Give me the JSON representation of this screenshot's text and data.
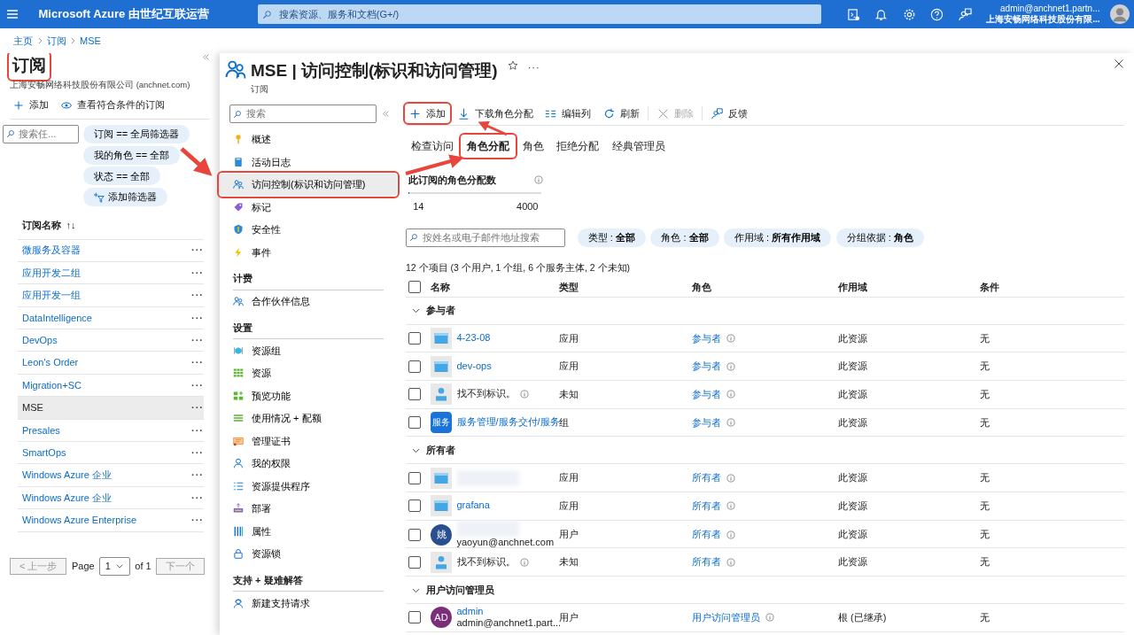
{
  "topbar": {
    "brand": "Microsoft Azure 由世纪互联运营",
    "search": {
      "placeholder": "搜索资源、服务和文档(G+/)"
    },
    "account": {
      "email": "admin@anchnet1.partn...",
      "org": "上海安畅网络科技股份有限..."
    }
  },
  "breadcrumb": [
    "主页",
    "订阅",
    "MSE"
  ],
  "subscriptions": {
    "title": "订阅",
    "annotated": true,
    "subtitle": "上海安畅网络科技股份有限公司 (anchnet.com)",
    "toolbar": [
      "添加",
      "查看符合条件的订阅"
    ],
    "search": {
      "placeholder": "搜索任..."
    },
    "filters": [
      {
        "label": "订阅 == 全局筛选器",
        "kind": "filter"
      },
      {
        "label": "我的角色 == 全部",
        "kind": "filter"
      },
      {
        "label": "状态 == 全部",
        "kind": "filter"
      },
      {
        "label": "添加筛选器",
        "kind": "add"
      }
    ],
    "column": "订阅名称",
    "sort": "↑↓",
    "rows": [
      {
        "name": "微服务及容器",
        "more": "···",
        "selected": false
      },
      {
        "name": "应用开发二组",
        "more": "···",
        "selected": false
      },
      {
        "name": "应用开发一组",
        "more": "···",
        "selected": false
      },
      {
        "name": "DataIntelligence",
        "more": "···",
        "selected": false
      },
      {
        "name": "DevOps",
        "more": "···",
        "selected": false
      },
      {
        "name": "Leon's Order",
        "more": "···",
        "selected": false
      },
      {
        "name": "Migration+SC",
        "more": "···",
        "selected": false
      },
      {
        "name": "MSE",
        "more": "···",
        "selected": true
      },
      {
        "name": "Presales",
        "more": "···",
        "selected": false
      },
      {
        "name": "SmartOps",
        "more": "···",
        "selected": false
      },
      {
        "name": "Windows Azure 企业",
        "more": "···",
        "selected": false
      },
      {
        "name": "Windows Azure 企业",
        "more": "···",
        "selected": false
      },
      {
        "name": "Windows Azure Enterprise",
        "more": "···",
        "selected": false
      }
    ],
    "pagination": {
      "prev": "< 上一步",
      "page_label": "Page",
      "page": "1",
      "of": "of 1",
      "next": "下一个"
    }
  },
  "blade": {
    "title": "MSE | 访问控制(标识和访问管理)",
    "subtitle": "订阅",
    "more": "···",
    "nav_search": {
      "placeholder": "搜索"
    },
    "nav": [
      {
        "kind": "item",
        "label": "概述",
        "selected": false,
        "annotated": false
      },
      {
        "kind": "item",
        "label": "活动日志",
        "selected": false,
        "annotated": false
      },
      {
        "kind": "item",
        "label": "访问控制(标识和访问管理)",
        "selected": true,
        "annotated": true
      },
      {
        "kind": "item",
        "label": "标记",
        "selected": false,
        "annotated": false
      },
      {
        "kind": "item",
        "label": "安全性",
        "selected": false,
        "annotated": false
      },
      {
        "kind": "item",
        "label": "事件",
        "selected": false,
        "annotated": false
      },
      {
        "kind": "header",
        "label": "计费"
      },
      {
        "kind": "item",
        "label": "合作伙伴信息",
        "selected": false,
        "annotated": false
      },
      {
        "kind": "header",
        "label": "设置"
      },
      {
        "kind": "item",
        "label": "资源组",
        "selected": false,
        "annotated": false
      },
      {
        "kind": "item",
        "label": "资源",
        "selected": false,
        "annotated": false
      },
      {
        "kind": "item",
        "label": "预览功能",
        "selected": false,
        "annotated": false
      },
      {
        "kind": "item",
        "label": "使用情况 + 配额",
        "selected": false,
        "annotated": false
      },
      {
        "kind": "item",
        "label": "管理证书",
        "selected": false,
        "annotated": false
      },
      {
        "kind": "item",
        "label": "我的权限",
        "selected": false,
        "annotated": false
      },
      {
        "kind": "item",
        "label": "资源提供程序",
        "selected": false,
        "annotated": false
      },
      {
        "kind": "item",
        "label": "部署",
        "selected": false,
        "annotated": false
      },
      {
        "kind": "item",
        "label": "属性",
        "selected": false,
        "annotated": false
      },
      {
        "kind": "item",
        "label": "资源锁",
        "selected": false,
        "annotated": false
      },
      {
        "kind": "header",
        "label": "支持 + 疑难解答"
      },
      {
        "kind": "item",
        "label": "新建支持请求",
        "selected": false,
        "annotated": false
      }
    ],
    "toolbar": [
      {
        "label": "添加",
        "disabled": false,
        "annotated": true
      },
      {
        "label": "下载角色分配",
        "disabled": false,
        "annotated": false
      },
      {
        "label": "编辑列",
        "disabled": false,
        "annotated": false
      },
      {
        "label": "刷新",
        "disabled": false,
        "annotated": false
      },
      {
        "label": "删除",
        "disabled": true,
        "annotated": false
      },
      {
        "label": "反馈",
        "disabled": false,
        "annotated": false
      }
    ],
    "tabs": [
      {
        "label": "检查访问",
        "selected": false,
        "annotated": false
      },
      {
        "label": "角色分配",
        "selected": true,
        "annotated": true
      },
      {
        "label": "角色",
        "selected": false,
        "annotated": false
      },
      {
        "label": "拒绝分配",
        "selected": false,
        "annotated": false
      },
      {
        "label": "经典管理员",
        "selected": false,
        "annotated": false
      }
    ],
    "metric": {
      "title": "此订阅的角色分配数",
      "level": 0.0035,
      "value": "14",
      "max": "4000"
    },
    "search": {
      "placeholder": "按姓名或电子邮件地址搜索"
    },
    "filters": [
      "类型 :**全部**",
      "角色 :**全部**",
      "作用域 :**所有作用域**",
      "分组依据 :**角色**"
    ],
    "summary": "12 个项目 (3 个用户, 1 个组, 6 个服务主体, 2 个未知)",
    "columns": [
      "名称",
      "类型",
      "角色",
      "作用域",
      "条件"
    ],
    "header_checked": false,
    "groups": [
      {
        "name": "参与者",
        "expanded": true,
        "rows": [
          {
            "kind": "app",
            "name": "4-23-08",
            "type": "应用",
            "role": "参与者",
            "scope": "此资源",
            "condition": "无",
            "checked": false
          },
          {
            "kind": "app",
            "name": "dev-ops",
            "type": "应用",
            "role": "参与者",
            "scope": "此资源",
            "condition": "无",
            "checked": false
          },
          {
            "kind": "unknown",
            "name": "找不到标识。",
            "type": "未知",
            "role": "参与者",
            "scope": "此资源",
            "condition": "无",
            "checked": false
          },
          {
            "kind": "group",
            "avatar": "服务",
            "color": "#1a73d8",
            "name": "服务管理/服务交付/服务",
            "type": "组",
            "role": "参与者",
            "scope": "此资源",
            "condition": "无",
            "checked": false
          }
        ]
      },
      {
        "name": "所有者",
        "expanded": true,
        "rows": [
          {
            "kind": "app",
            "type": "应用",
            "role": "所有者",
            "scope": "此资源",
            "condition": "无",
            "checked": false
          },
          {
            "kind": "app",
            "name": "grafana",
            "type": "应用",
            "role": "所有者",
            "scope": "此资源",
            "condition": "无",
            "checked": false
          },
          {
            "kind": "user",
            "avatar": "姚",
            "color": "#2a4f8f",
            "email": "yaoyun@anchnet.com",
            "type": "用户",
            "role": "所有者",
            "scope": "此资源",
            "condition": "无",
            "checked": false
          },
          {
            "kind": "unknown",
            "name": "找不到标识。",
            "type": "未知",
            "role": "所有者",
            "scope": "此资源",
            "condition": "无",
            "checked": false
          }
        ]
      },
      {
        "name": "用户访问管理员",
        "expanded": true,
        "rows": [
          {
            "kind": "user",
            "avatar": "AD",
            "color": "#7b2f7b",
            "name": "admin",
            "email": "admin@anchnet1.part...",
            "type": "用户",
            "role": "用户访问管理员",
            "scope": "根 (已继承)",
            "condition": "无",
            "checked": false
          }
        ]
      }
    ]
  }
}
